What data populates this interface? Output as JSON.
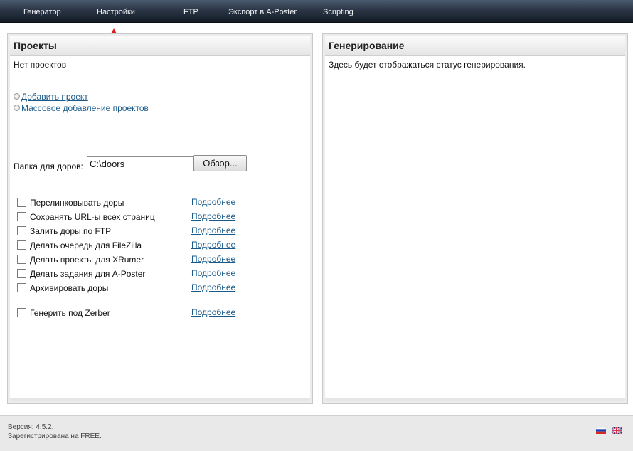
{
  "nav": {
    "items": [
      "Генератор",
      "Настройки",
      "FTP",
      "Экспорт в A-Poster",
      "Scripting"
    ]
  },
  "projects": {
    "title": "Проекты",
    "empty_text": "Нет проектов",
    "add_project": "Добавить проект",
    "bulk_add": "Массовое добавление проектов",
    "folder_label": "Папка для доров:",
    "folder_value": "C:\\doors",
    "browse_label": "Обзор...",
    "options": [
      {
        "label": "Перелинковывать доры",
        "checked": false,
        "more": "Подробнее"
      },
      {
        "label": "Сохранять URL-ы всех страниц",
        "checked": false,
        "more": "Подробнее"
      },
      {
        "label": "Залить доры по FTP",
        "checked": false,
        "more": "Подробнее"
      },
      {
        "label": "Делать очередь для FileZilla",
        "checked": false,
        "more": "Подробнее"
      },
      {
        "label": "Делать проекты для XRumer",
        "checked": false,
        "more": "Подробнее"
      },
      {
        "label": "Делать задания для A-Poster",
        "checked": false,
        "more": "Подробнее"
      },
      {
        "label": "Архивировать доры",
        "checked": false,
        "more": "Подробнее"
      },
      {
        "label": "Генерить под Zerber",
        "checked": false,
        "more": "Подробнее"
      }
    ]
  },
  "generation": {
    "title": "Генерирование",
    "status_text": "Здесь будет отображаться статус генерирования."
  },
  "footer": {
    "version": "Версия: 4.5.2.",
    "registered": "Зарегистрирована на FREE."
  },
  "flags": {
    "ru_icon": "flag-ru-icon",
    "en_icon": "flag-uk-icon"
  },
  "colors": {
    "link": "#1a5a8a",
    "annotation_arrow": "#e11a1a"
  }
}
